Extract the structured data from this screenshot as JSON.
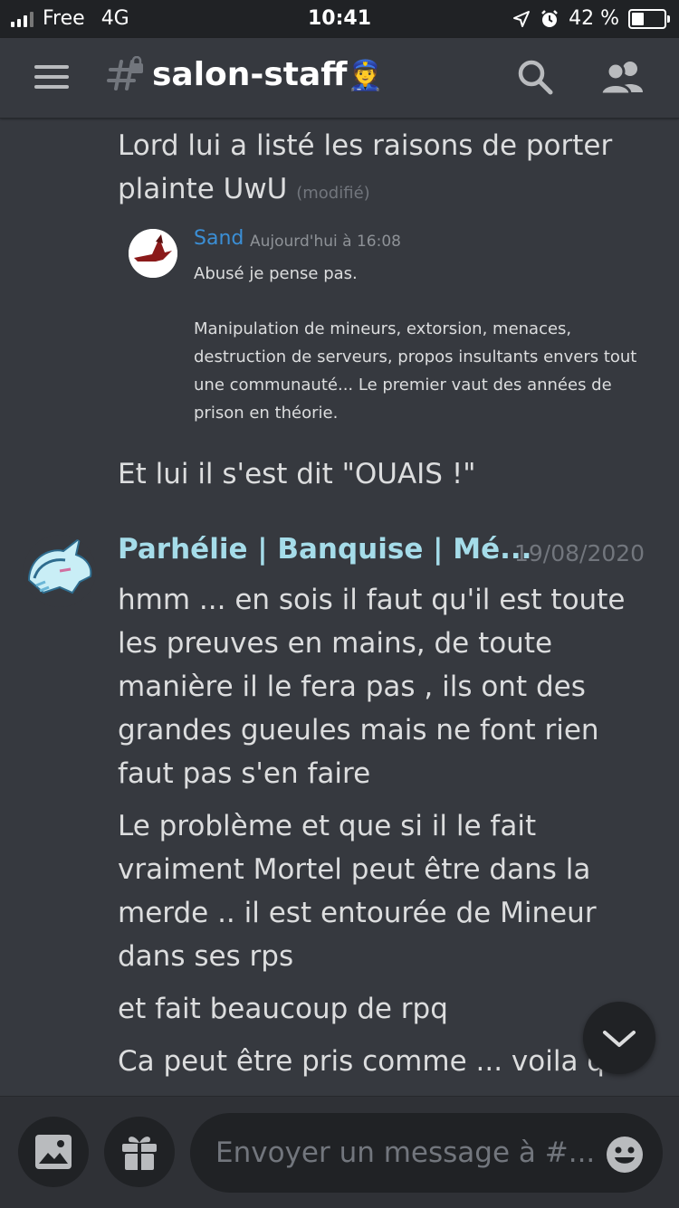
{
  "status_bar": {
    "carrier": "Free",
    "network": "4G",
    "time": "10:41",
    "battery_percent": "42 %",
    "battery_level": 0.42
  },
  "header": {
    "channel_icon": "#",
    "channel_name": "salon-staff",
    "channel_emoji": "👮",
    "icons": [
      "menu-icon",
      "locked-channel-icon",
      "search-icon",
      "members-icon"
    ]
  },
  "messages": {
    "first_text": "Lord lui a listé les raisons de porter plainte UwU",
    "first_edited": "(modifié)",
    "quote": {
      "author": "Sand",
      "date": "Aujourd'hui à 16:08",
      "line1": "Abusé je pense pas.",
      "line2": "Manipulation de mineurs, extorsion, menaces, destruction de serveurs, propos insultants envers tout une communauté... Le premier vaut des années de prison en théorie."
    },
    "second_text": "Et lui il s'est dit \"OUAIS !\"",
    "group": {
      "author": "Parhélie | Banquise | Mé...",
      "timestamp": "19/08/2020",
      "msg1": "hmm ... en sois il faut qu'il est toute les preuves en mains, de toute manière il le fera pas , ils ont des grandes gueules mais ne font rien faut pas s'en faire",
      "msg2": "Le problème et que si il le fait vraiment Mortel peut être dans la merde .. il est entourée de Mineur dans ses rps",
      "msg3": "et fait beaucoup de rpq",
      "msg4": "Ca peut être pris comme ... voila q..."
    }
  },
  "composer": {
    "placeholder": "Envoyer un message à #..."
  },
  "colors": {
    "background": "#36393f",
    "header_bg": "#36393f",
    "status_bar_bg": "#202225",
    "composer_bg": "#2f3136",
    "username_color": "#a5dce9",
    "quote_author_color": "#3b8fd6"
  }
}
